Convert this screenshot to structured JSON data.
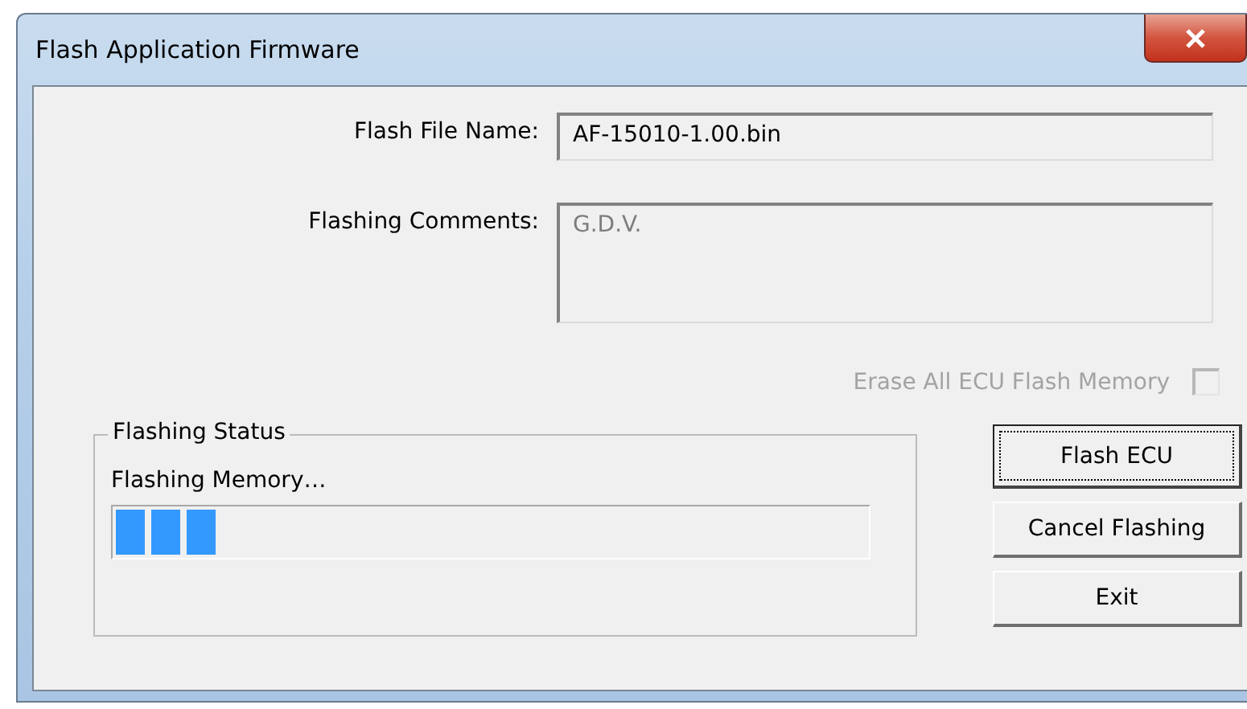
{
  "window": {
    "title": "Flash Application Firmware"
  },
  "fields": [
    {
      "label": "Flash File Name:",
      "value": "AF-15010-1.00.bin",
      "kind": "line",
      "disabled": false
    },
    {
      "label": "Flashing Comments:",
      "value": "G.D.V.",
      "kind": "area",
      "disabled": true
    }
  ],
  "erase_option": {
    "label": "Erase All ECU Flash Memory",
    "checked": false,
    "disabled": true
  },
  "status_group": {
    "title": "Flashing Status",
    "message": "Flashing Memory…",
    "level": 0.14
  },
  "buttons": [
    {
      "label": "Flash ECU",
      "focused": true
    },
    {
      "label": "Cancel Flashing",
      "focused": false
    },
    {
      "label": "Exit",
      "focused": false
    }
  ]
}
